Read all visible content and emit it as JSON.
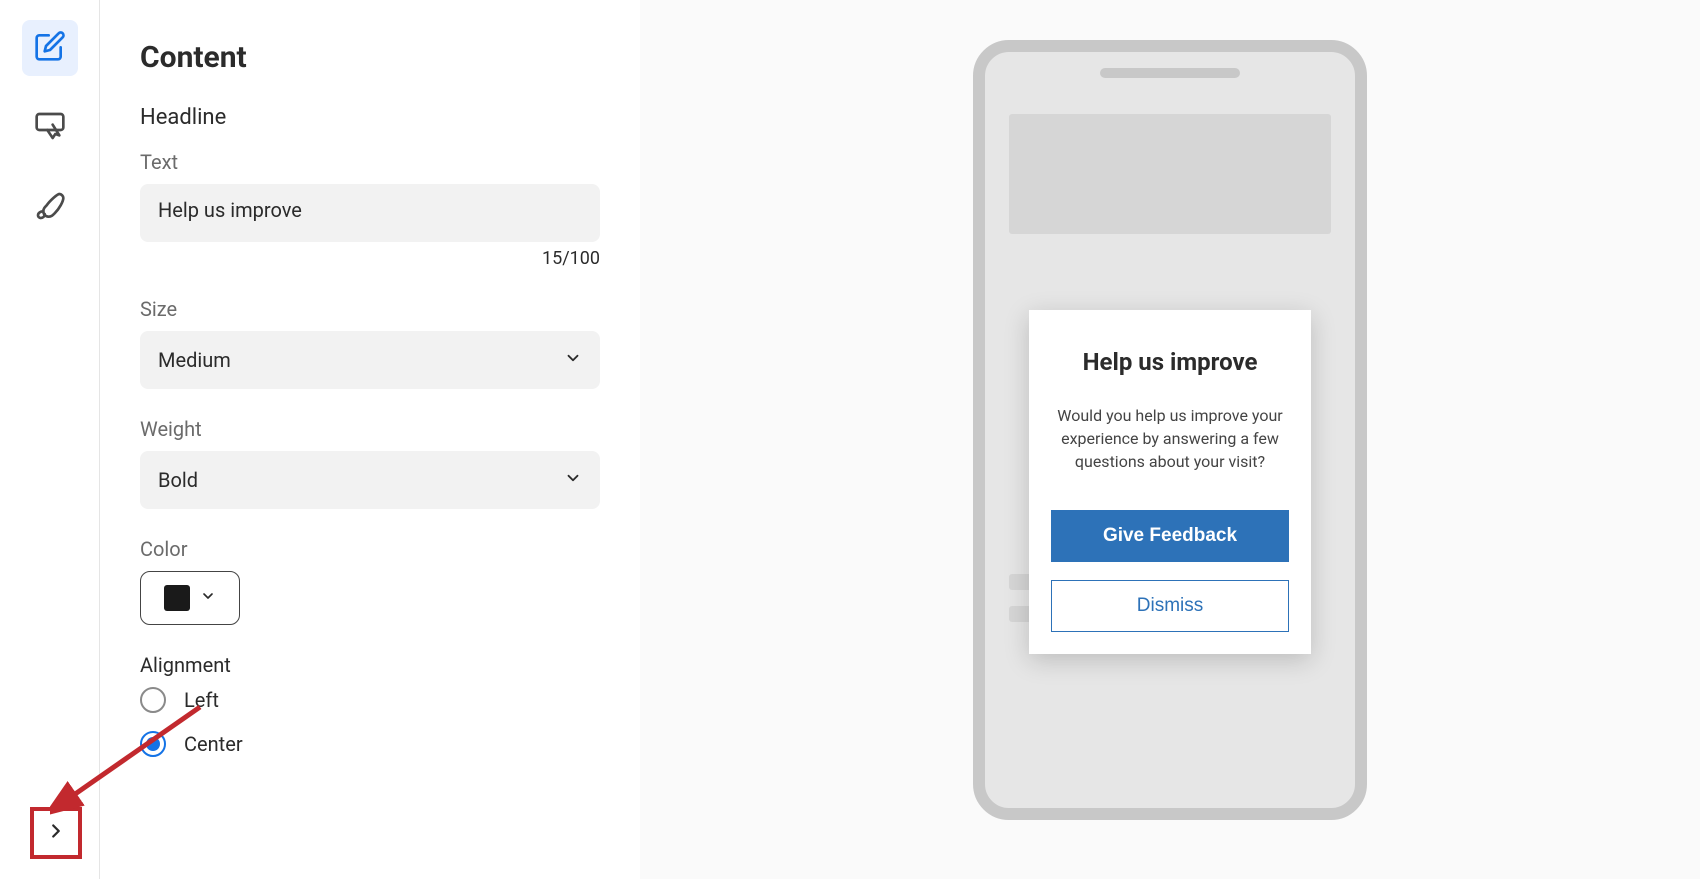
{
  "panel": {
    "title": "Content",
    "section_headline": "Headline",
    "text": {
      "label": "Text",
      "value": "Help us improve",
      "counter": "15/100"
    },
    "size": {
      "label": "Size",
      "value": "Medium"
    },
    "weight": {
      "label": "Weight",
      "value": "Bold"
    },
    "color": {
      "label": "Color",
      "value_hex": "#1a1a1a"
    },
    "alignment": {
      "label": "Alignment",
      "options": [
        "Left",
        "Center"
      ],
      "selected": "Center"
    }
  },
  "preview": {
    "headline": "Help us improve",
    "body": "Would you help us improve your experience by answering a few questions about your visit?",
    "primary_btn": "Give Feedback",
    "secondary_btn": "Dismiss"
  },
  "rail": {
    "items": [
      "content-icon",
      "cursor-icon",
      "brush-icon"
    ],
    "active": "content-icon"
  }
}
